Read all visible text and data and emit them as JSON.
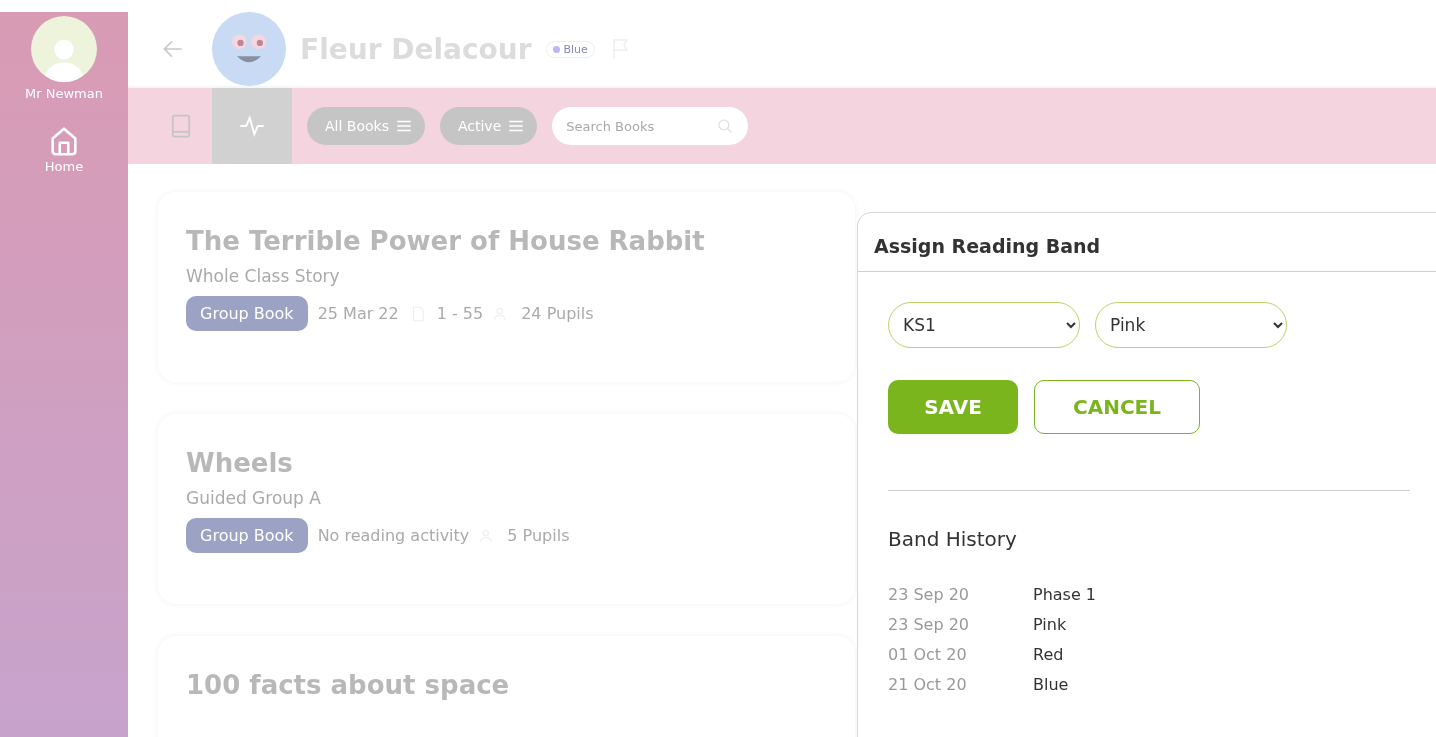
{
  "sidebar": {
    "user": "Mr Newman",
    "items": [
      {
        "label": "Home",
        "selected": true
      }
    ]
  },
  "header": {
    "student_name": "Fleur Delacour",
    "band_badge": "Blue"
  },
  "toolbar": {
    "tabs": [
      {
        "kind": "book",
        "selected": false
      },
      {
        "kind": "activity",
        "selected": true
      }
    ],
    "filters": [
      {
        "label": "All Books"
      },
      {
        "label": "Active"
      }
    ],
    "search": {
      "placeholder": "Search Books"
    }
  },
  "books": [
    {
      "title": "The Terrible Power of House Rabbit",
      "group": "Whole Class Story",
      "tag": "Group Book",
      "date": "25 Mar 22",
      "pages": "1 - 55",
      "pupils": "24 Pupils"
    },
    {
      "title": "Wheels",
      "group": "Guided Group A",
      "tag": "Group Book",
      "activity": "No reading activity",
      "pupils": "5 Pupils"
    },
    {
      "title": "100 facts about space"
    }
  ],
  "panel": {
    "title": "Assign Reading Band",
    "selects": [
      {
        "value": "KS1"
      },
      {
        "value": "Pink"
      }
    ],
    "buttons": [
      {
        "label": "SAVE",
        "kind": "primary"
      },
      {
        "label": "CANCEL",
        "kind": "secondary"
      }
    ],
    "history_title": "Band History",
    "history": [
      {
        "date": "23 Sep 20",
        "band": "Phase 1"
      },
      {
        "date": "23 Sep 20",
        "band": "Pink"
      },
      {
        "date": "01 Oct 20",
        "band": "Red"
      },
      {
        "date": "21 Oct 20",
        "band": "Blue"
      }
    ]
  }
}
